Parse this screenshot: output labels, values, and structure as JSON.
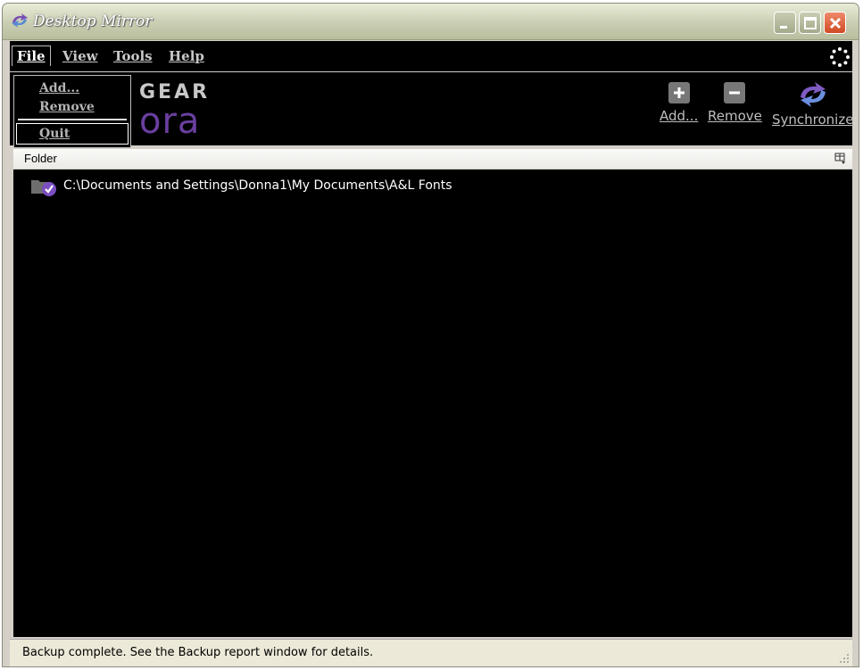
{
  "window": {
    "title": "Desktop Mirror"
  },
  "menu": {
    "file": "File",
    "view": "View",
    "tools": "Tools",
    "help": "Help"
  },
  "file_menu": {
    "add": "Add...",
    "remove": "Remove",
    "quit": "Quit"
  },
  "logo": {
    "line1": "GEAR",
    "line2": "ora"
  },
  "toolbar": {
    "add": "Add...",
    "remove": "Remove",
    "synchronize": "Synchronize"
  },
  "list": {
    "header": "Folder",
    "rows": [
      {
        "path": "C:\\Documents and Settings\\Donna1\\My Documents\\A&L Fonts"
      }
    ]
  },
  "status": {
    "text": "Backup complete.  See the Backup report window for details."
  },
  "colors": {
    "accent": "#6a3fa0",
    "background": "#000000",
    "menu_text": "#c8c8c8"
  }
}
